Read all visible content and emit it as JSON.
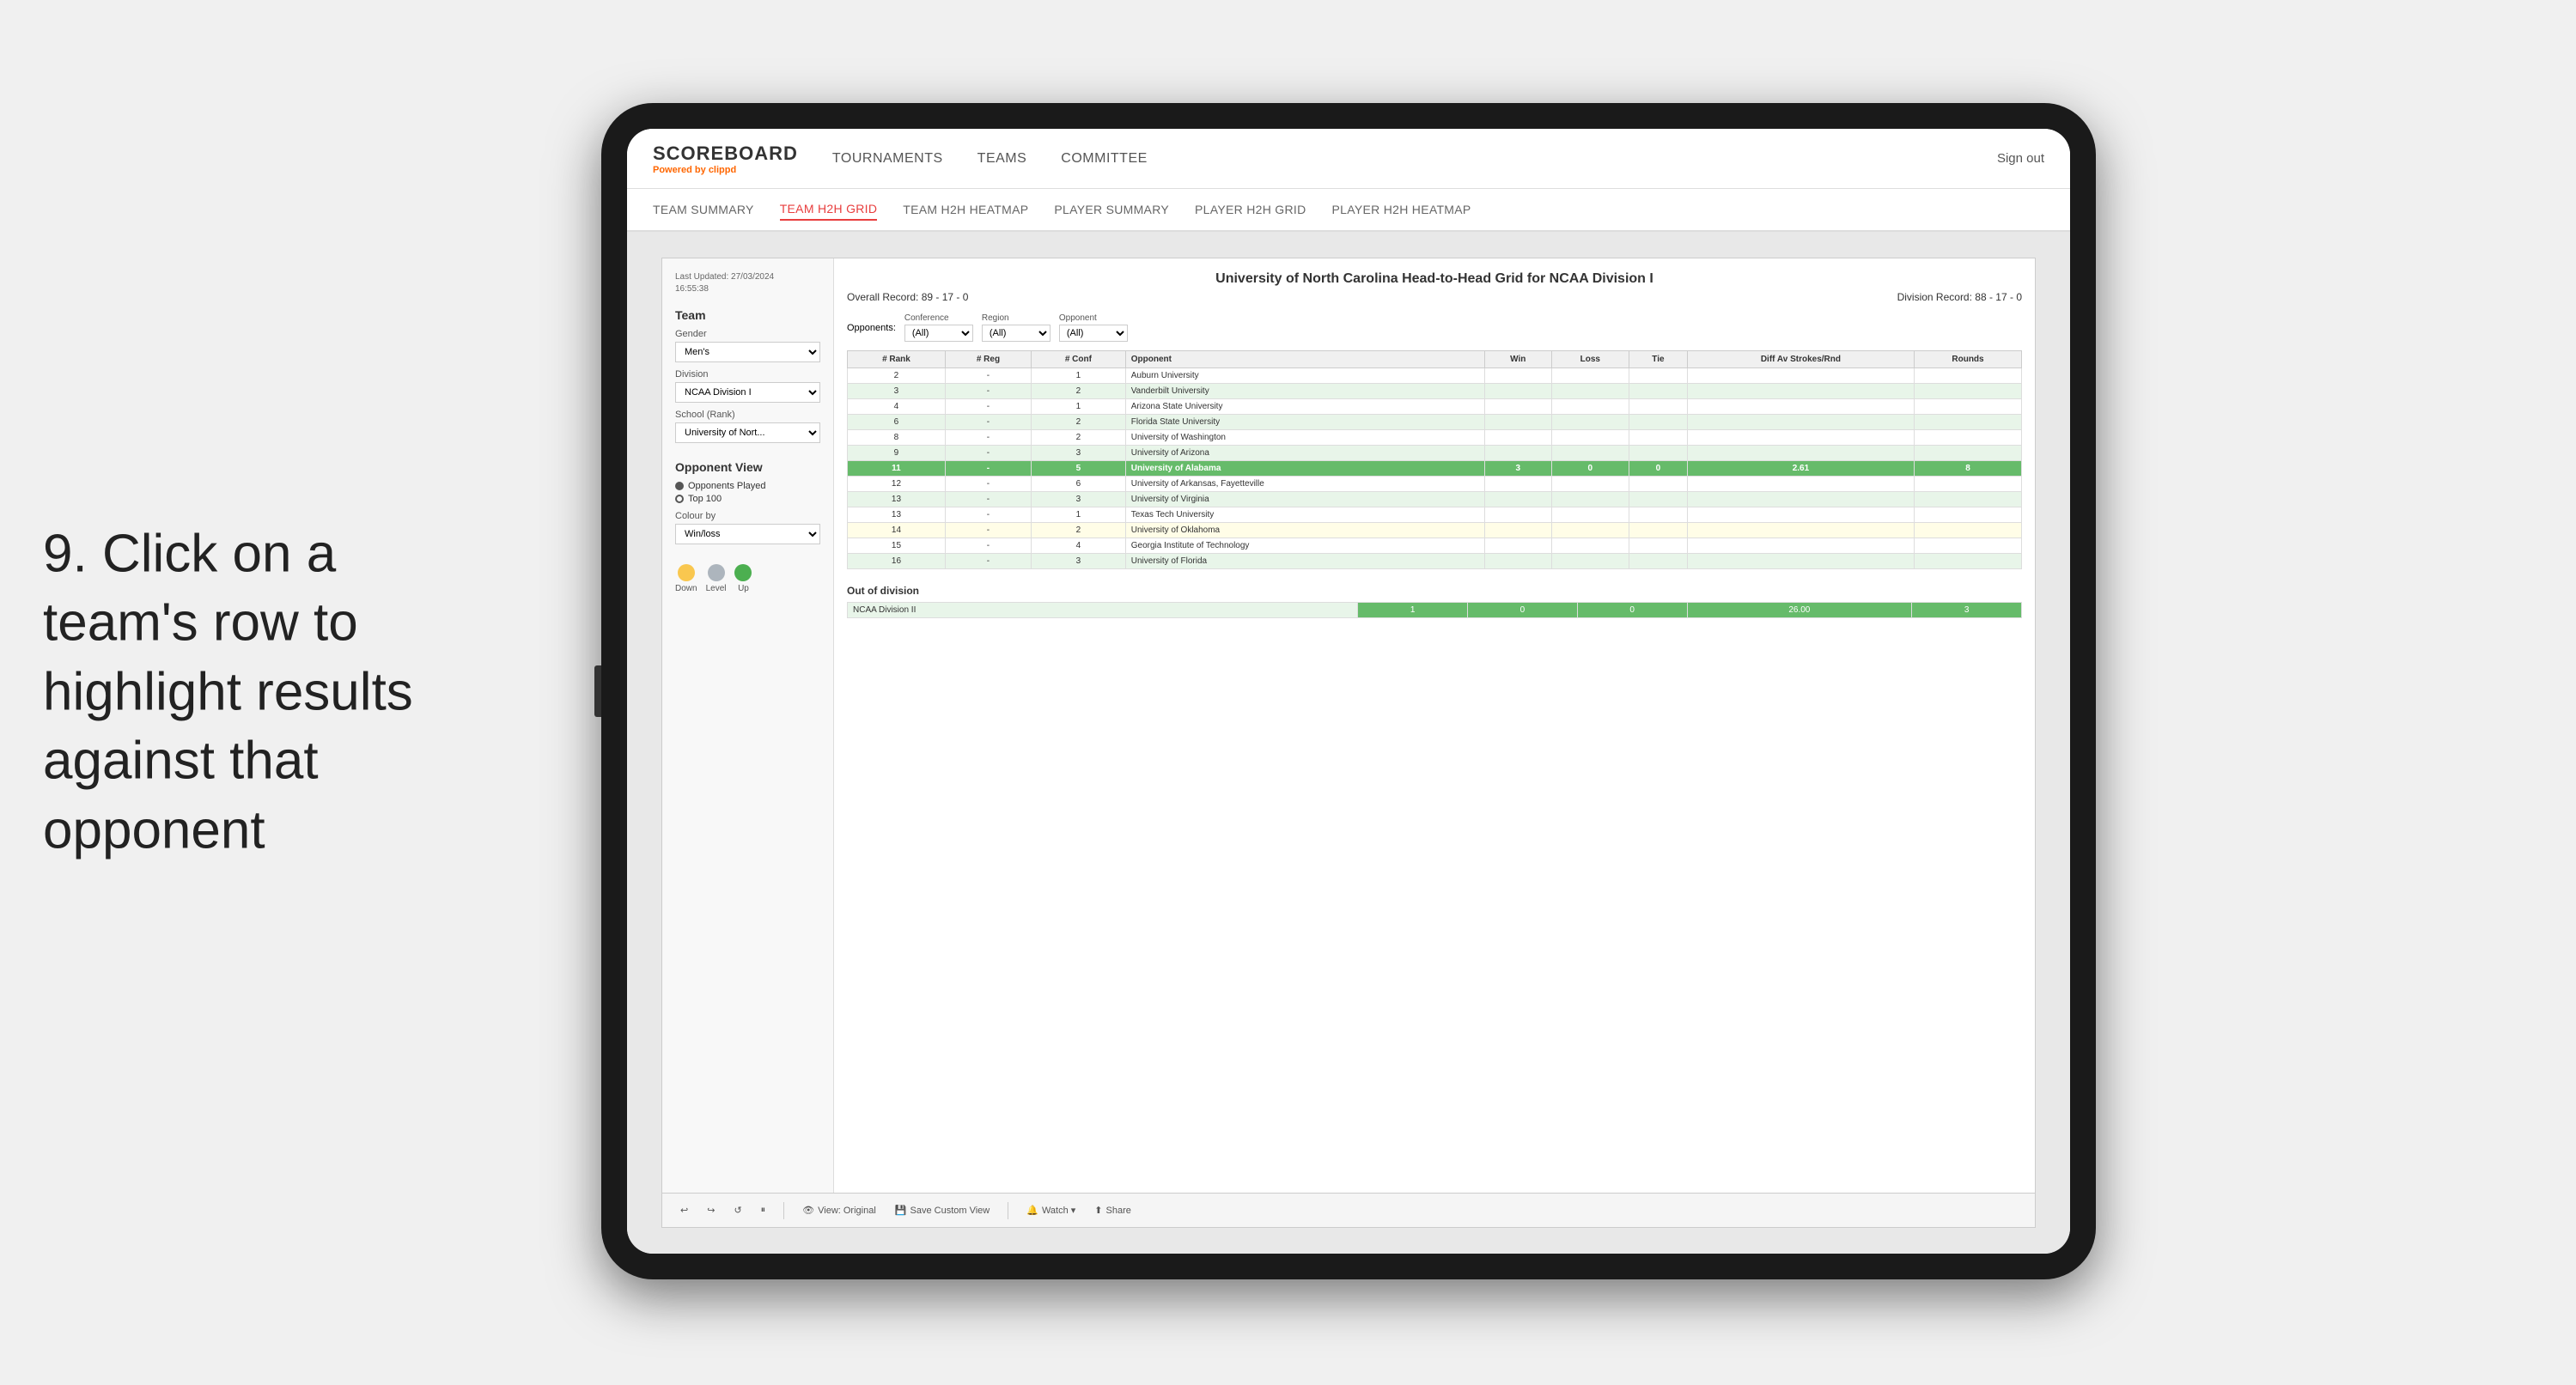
{
  "instruction": {
    "number": "9.",
    "text": "Click on a team's row to highlight results against that opponent"
  },
  "nav": {
    "logo": "SCOREBOARD",
    "powered_by": "Powered by",
    "brand": "clippd",
    "items": [
      "TOURNAMENTS",
      "TEAMS",
      "COMMITTEE"
    ],
    "sign_out": "Sign out"
  },
  "sub_nav": {
    "items": [
      "TEAM SUMMARY",
      "TEAM H2H GRID",
      "TEAM H2H HEATMAP",
      "PLAYER SUMMARY",
      "PLAYER H2H GRID",
      "PLAYER H2H HEATMAP"
    ],
    "active": "TEAM H2H GRID"
  },
  "left_panel": {
    "last_updated_label": "Last Updated: 27/03/2024",
    "last_updated_time": "16:55:38",
    "team_label": "Team",
    "gender_label": "Gender",
    "gender_value": "Men's",
    "division_label": "Division",
    "division_value": "NCAA Division I",
    "school_rank_label": "School (Rank)",
    "school_rank_value": "University of Nort...",
    "opponent_view_label": "Opponent View",
    "opponents_played": "Opponents Played",
    "top_100": "Top 100",
    "colour_by_label": "Colour by",
    "colour_by_value": "Win/loss",
    "legend": {
      "down_label": "Down",
      "level_label": "Level",
      "up_label": "Up",
      "down_color": "#f9c74f",
      "level_color": "#adb5bd",
      "up_color": "#4caf50"
    }
  },
  "grid": {
    "title": "University of North Carolina Head-to-Head Grid for NCAA Division I",
    "overall_record_label": "Overall Record:",
    "overall_record": "89 - 17 - 0",
    "division_record_label": "Division Record:",
    "division_record": "88 - 17 - 0",
    "filters": {
      "opponents_label": "Opponents:",
      "conference_label": "Conference",
      "conference_value": "(All)",
      "region_label": "Region",
      "region_value": "(All)",
      "opponent_label": "Opponent",
      "opponent_value": "(All)"
    },
    "columns": [
      "# Rank",
      "# Reg",
      "# Conf",
      "Opponent",
      "Win",
      "Loss",
      "Tie",
      "Diff Av Strokes/Rnd",
      "Rounds"
    ],
    "rows": [
      {
        "rank": "2",
        "reg": "-",
        "conf": "1",
        "opponent": "Auburn University",
        "win": "",
        "loss": "",
        "tie": "",
        "diff": "",
        "rounds": "",
        "style": "normal"
      },
      {
        "rank": "3",
        "reg": "-",
        "conf": "2",
        "opponent": "Vanderbilt University",
        "win": "",
        "loss": "",
        "tie": "",
        "diff": "",
        "rounds": "",
        "style": "light-green"
      },
      {
        "rank": "4",
        "reg": "-",
        "conf": "1",
        "opponent": "Arizona State University",
        "win": "",
        "loss": "",
        "tie": "",
        "diff": "",
        "rounds": "",
        "style": "normal"
      },
      {
        "rank": "6",
        "reg": "-",
        "conf": "2",
        "opponent": "Florida State University",
        "win": "",
        "loss": "",
        "tie": "",
        "diff": "",
        "rounds": "",
        "style": "light-green"
      },
      {
        "rank": "8",
        "reg": "-",
        "conf": "2",
        "opponent": "University of Washington",
        "win": "",
        "loss": "",
        "tie": "",
        "diff": "",
        "rounds": "",
        "style": "normal"
      },
      {
        "rank": "9",
        "reg": "-",
        "conf": "3",
        "opponent": "University of Arizona",
        "win": "",
        "loss": "",
        "tie": "",
        "diff": "",
        "rounds": "",
        "style": "light-green"
      },
      {
        "rank": "11",
        "reg": "-",
        "conf": "5",
        "opponent": "University of Alabama",
        "win": "3",
        "loss": "0",
        "tie": "0",
        "diff": "2.61",
        "rounds": "8",
        "style": "highlighted"
      },
      {
        "rank": "12",
        "reg": "-",
        "conf": "6",
        "opponent": "University of Arkansas, Fayetteville",
        "win": "",
        "loss": "",
        "tie": "",
        "diff": "",
        "rounds": "",
        "style": "normal"
      },
      {
        "rank": "13",
        "reg": "-",
        "conf": "3",
        "opponent": "University of Virginia",
        "win": "",
        "loss": "",
        "tie": "",
        "diff": "",
        "rounds": "",
        "style": "light-green"
      },
      {
        "rank": "13",
        "reg": "-",
        "conf": "1",
        "opponent": "Texas Tech University",
        "win": "",
        "loss": "",
        "tie": "",
        "diff": "",
        "rounds": "",
        "style": "normal"
      },
      {
        "rank": "14",
        "reg": "-",
        "conf": "2",
        "opponent": "University of Oklahoma",
        "win": "",
        "loss": "",
        "tie": "",
        "diff": "",
        "rounds": "",
        "style": "light-yellow"
      },
      {
        "rank": "15",
        "reg": "-",
        "conf": "4",
        "opponent": "Georgia Institute of Technology",
        "win": "",
        "loss": "",
        "tie": "",
        "diff": "",
        "rounds": "",
        "style": "normal"
      },
      {
        "rank": "16",
        "reg": "-",
        "conf": "3",
        "opponent": "University of Florida",
        "win": "",
        "loss": "",
        "tie": "",
        "diff": "",
        "rounds": "",
        "style": "light-green"
      }
    ],
    "out_of_division_label": "Out of division",
    "out_of_division_row": {
      "name": "NCAA Division II",
      "win": "1",
      "loss": "0",
      "tie": "0",
      "diff": "26.00",
      "rounds": "3"
    }
  },
  "toolbar": {
    "undo_label": "↩",
    "redo_label": "↪",
    "view_label": "View: Original",
    "save_custom_label": "Save Custom View",
    "watch_label": "Watch ▾",
    "share_label": "Share"
  }
}
